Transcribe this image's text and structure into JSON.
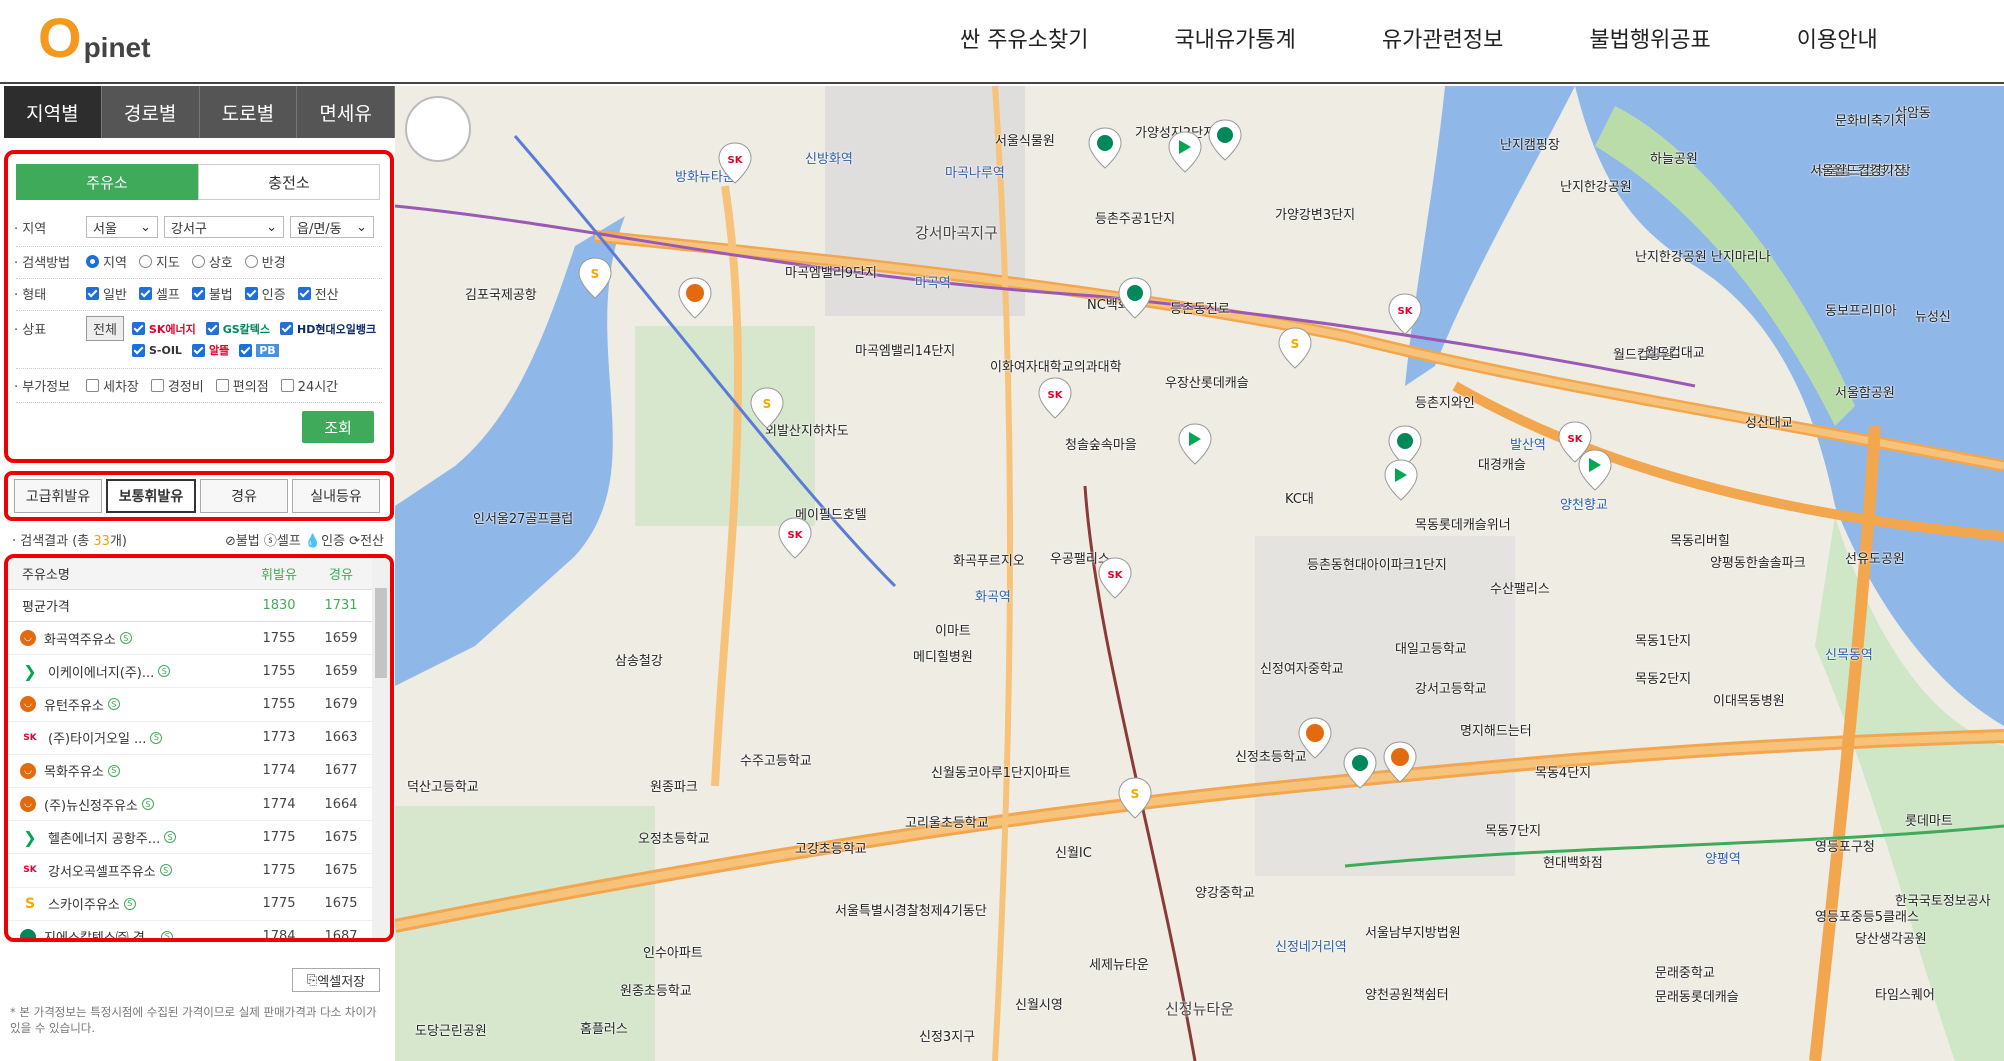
{
  "header": {
    "logo_o": "O",
    "logo_rest": "pinet",
    "nav": [
      "싼 주유소찾기",
      "국내유가통계",
      "유가관련정보",
      "불법행위공표",
      "이용안내"
    ]
  },
  "side_tabs": [
    "지역별",
    "경로별",
    "도로별",
    "면세유"
  ],
  "filter": {
    "subtabs": [
      "주유소",
      "충전소"
    ],
    "region_label": "지역",
    "region_sido": "서울",
    "region_gu": "강서구",
    "region_dong": "읍/면/동",
    "method_label": "검색방법",
    "methods": [
      "지역",
      "지도",
      "상호",
      "반경"
    ],
    "type_label": "형태",
    "types": [
      "일반",
      "셀프",
      "불법",
      "인증",
      "전산"
    ],
    "brand_label": "상표",
    "brand_all": "전체",
    "brands_row1": [
      "SK에너지",
      "GS칼텍스",
      "HD현대오일뱅크"
    ],
    "brands_row2": [
      "S-OIL",
      "알뜰",
      "PB"
    ],
    "extra_label": "부가정보",
    "extras": [
      "세차장",
      "경정비",
      "편의점",
      "24시간"
    ],
    "search_button": "조회"
  },
  "fuel_tabs": [
    "고급휘발유",
    "보통휘발유",
    "경유",
    "실내등유"
  ],
  "result": {
    "prefix": "검색결과 (총 ",
    "count": "33",
    "suffix": "개)",
    "legend": "⊘불법 ⓢ셀프 💧인증 ⟳전산"
  },
  "table": {
    "col_name": "주유소명",
    "col_gasoline": "휘발유",
    "col_diesel": "경유",
    "avg_label": "평균가격",
    "avg_gasoline": "1830",
    "avg_diesel": "1731",
    "rows": [
      {
        "name": "화곡역주유소",
        "brand": "alddeul",
        "gasoline": "1755",
        "diesel": "1659"
      },
      {
        "name": "이케이에너지(주)...",
        "brand": "hd",
        "gasoline": "1755",
        "diesel": "1659"
      },
      {
        "name": "유턴주유소",
        "brand": "alddeul",
        "gasoline": "1755",
        "diesel": "1679"
      },
      {
        "name": "(주)타이거오일 ...",
        "brand": "sk",
        "gasoline": "1773",
        "diesel": "1663"
      },
      {
        "name": "목화주유소",
        "brand": "alddeul",
        "gasoline": "1774",
        "diesel": "1677"
      },
      {
        "name": "(주)뉴신정주유소",
        "brand": "alddeul",
        "gasoline": "1774",
        "diesel": "1664"
      },
      {
        "name": "헬촌에너지 공항주...",
        "brand": "hd",
        "gasoline": "1775",
        "diesel": "1675"
      },
      {
        "name": "강서오곡셀프주유소",
        "brand": "sk",
        "gasoline": "1775",
        "diesel": "1675"
      },
      {
        "name": "스카이주유소",
        "brand": "soil",
        "gasoline": "1775",
        "diesel": "1675"
      },
      {
        "name": "지에스칼텍스㈜ 경...",
        "brand": "gs",
        "gasoline": "1784",
        "diesel": "1687"
      }
    ]
  },
  "excel_button": "엑셀저장",
  "note": "* 본 가격정보는 특정시점에 수집된 가격이므로 실제 판매가격과 다소 차이가 있을 수 있습니다.",
  "map_labels": [
    "김포국제공항",
    "강서마곡지구",
    "방화뉴타운",
    "인서울27골프클럽",
    "난지캠핑장",
    "난지한강공원",
    "월드컵공원",
    "서울월드컵경기장",
    "상암동",
    "가양성지2단지",
    "등촌주공1단지",
    "가양강변3단지",
    "NC백화점",
    "등촌동진로",
    "우장산롯데캐슬",
    "이화여자대학교의과대학",
    "청솔숲속마을",
    "외발산지하차도",
    "메이필드호텔",
    "화곡푸르지오",
    "우공팰리스",
    "이마트",
    "메디힐병원",
    "KC대",
    "목동롯데캐슬위너",
    "등촌동현대아이파크1단지",
    "수산팰리스",
    "목동1단지",
    "목동2단지",
    "이대목동병원",
    "대일고등학교",
    "신정여자중학교",
    "강서고등학교",
    "명지해드는터",
    "신정초등학교",
    "목동4단지",
    "목동7단지",
    "현대백화점",
    "신월IC",
    "신월동코아루1단지아파트",
    "고리울초등학교",
    "서울특별시경찰청제4기동단",
    "양강중학교",
    "서울남부지방법원",
    "신정뉴타운",
    "신정3지구",
    "양천공원책쉼터",
    "영등포구청",
    "당산생각공원",
    "롯데마트",
    "선유도공원",
    "양평역",
    "신정네거리역",
    "삼송철강",
    "덕산고등학교",
    "원종파크",
    "수주고등학교",
    "고강초등학교",
    "오정초등학교",
    "원종초등학교",
    "인수아파트",
    "홈플러스",
    "도당근린공원",
    "세제뉴타운",
    "신월시영",
    "화곡역",
    "발산역",
    "마곡역",
    "양천향교",
    "신방화역",
    "마곡나루역",
    "신목동역",
    "서울식물원",
    "마곡엠밸리9단지",
    "마곡엠밸리14단지",
    "등촌지와인",
    "대경캐슬",
    "목동리버힐",
    "양평동한솔솔파크",
    "한국국토정보공사",
    "영등포중등5클래스",
    "문래중학교",
    "문래동롯데캐슬",
    "타임스퀘어",
    "하늘공원",
    "문화비축기지",
    "서울월드컵경기장",
    "뉴성신",
    "동보프리미아",
    "서울함공원",
    "성산대교",
    "월드컵대교",
    "난지한강공원 난지마리나"
  ]
}
